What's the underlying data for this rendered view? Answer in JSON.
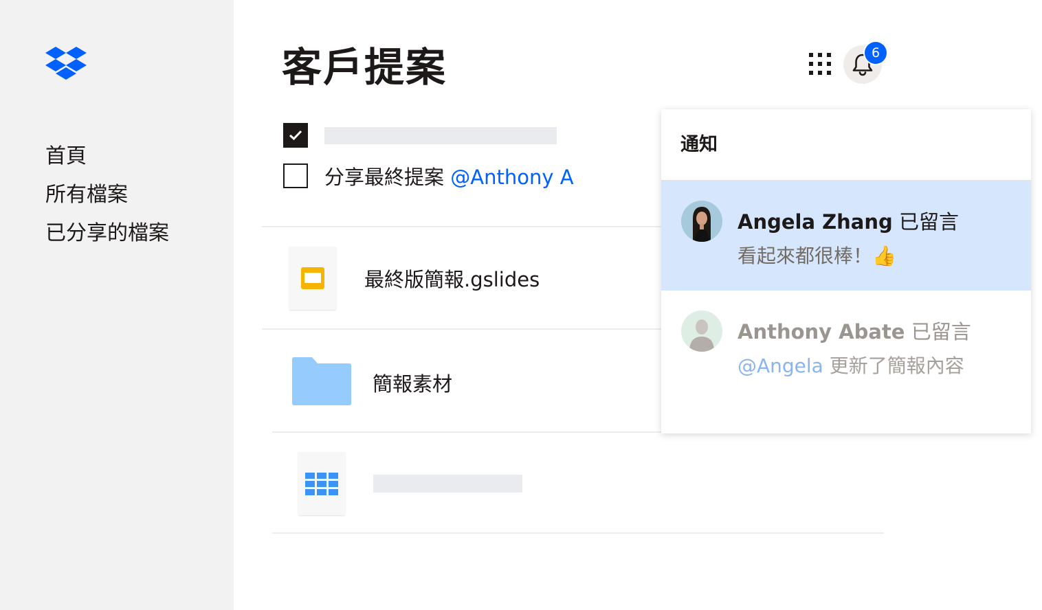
{
  "app": {
    "brand": "Dropbox",
    "accent_color": "#0061fe"
  },
  "sidebar": {
    "logo_icon": "dropbox-logo-icon",
    "items": [
      {
        "label": "首頁"
      },
      {
        "label": "所有檔案"
      },
      {
        "label": "已分享的檔案"
      }
    ]
  },
  "header": {
    "title": "客戶提案",
    "apps_icon": "grid-icon",
    "bell_icon": "bell-icon",
    "notification_count": "6"
  },
  "tasks": [
    {
      "checked": true,
      "text": ""
    },
    {
      "checked": false,
      "text": "分享最終提案",
      "mention": "@Anthony A"
    }
  ],
  "files": [
    {
      "name": "最終版簡報.gslides",
      "icon": "slides-file-icon"
    },
    {
      "name": "簡報素材",
      "icon": "folder-icon"
    },
    {
      "name": "",
      "icon": "spreadsheet-file-icon"
    }
  ],
  "notifications": {
    "title": "通知",
    "items": [
      {
        "author": "Angela Zhang",
        "action": "已留言",
        "message": "看起來都很棒！👍",
        "mention": "",
        "highlight_color": "#d6e6fd"
      },
      {
        "author": "Anthony Abate",
        "action": "已留言",
        "message": "更新了簡報內容",
        "mention": "@Angela"
      }
    ]
  }
}
